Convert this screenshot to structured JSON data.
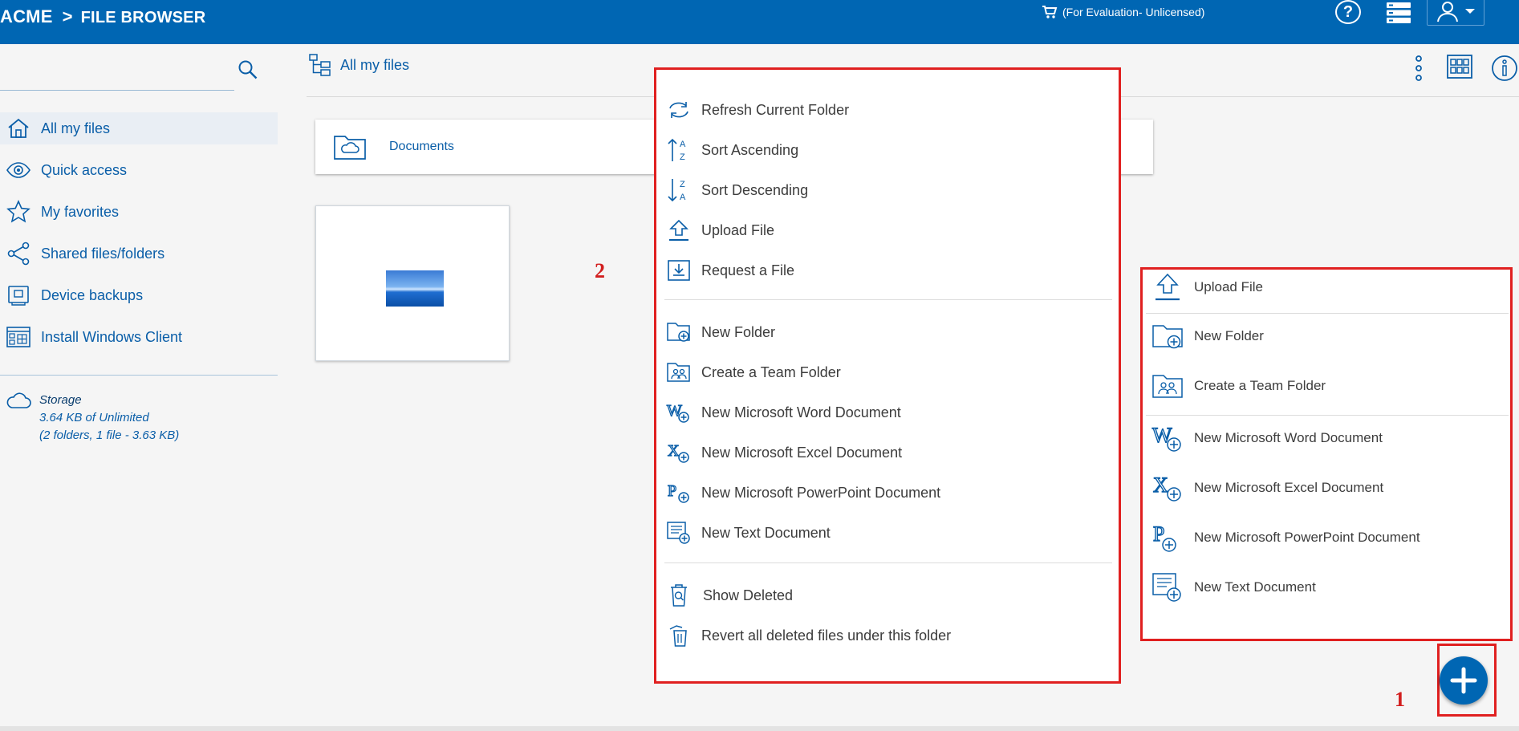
{
  "header": {
    "brand": "ACME",
    "separator": ">",
    "section": "FILE BROWSER",
    "license": "(For Evaluation- Unlicensed)",
    "help": "?"
  },
  "search": {
    "placeholder": ""
  },
  "sidebar": {
    "items": [
      {
        "label": "All my files",
        "icon": "home-icon"
      },
      {
        "label": "Quick access",
        "icon": "eye-icon"
      },
      {
        "label": "My favorites",
        "icon": "star-icon"
      },
      {
        "label": "Shared files/folders",
        "icon": "share-icon"
      },
      {
        "label": "Device backups",
        "icon": "device-backup-icon"
      },
      {
        "label": "Install Windows Client",
        "icon": "windows-client-icon"
      }
    ],
    "storage": {
      "title": "Storage",
      "usage": "3.64 KB of Unlimited",
      "details": "(2 folders, 1 file - 3.63 KB)"
    }
  },
  "breadcrumb": {
    "label": "All my files"
  },
  "files": {
    "folders": [
      {
        "name": "Documents"
      }
    ]
  },
  "context_menu": {
    "group1": [
      {
        "label": "Refresh Current Folder",
        "icon": "refresh-icon"
      },
      {
        "label": "Sort Ascending",
        "icon": "sort-ascending-icon"
      },
      {
        "label": "Sort Descending",
        "icon": "sort-descending-icon"
      },
      {
        "label": "Upload File",
        "icon": "upload-icon"
      },
      {
        "label": "Request a File",
        "icon": "request-file-icon"
      }
    ],
    "group2": [
      {
        "label": "New Folder",
        "icon": "new-folder-icon"
      },
      {
        "label": "Create a Team Folder",
        "icon": "team-folder-icon"
      },
      {
        "label": "New Microsoft Word Document",
        "icon": "word-add-icon"
      },
      {
        "label": "New Microsoft Excel Document",
        "icon": "excel-add-icon"
      },
      {
        "label": "New Microsoft PowerPoint Document",
        "icon": "powerpoint-add-icon"
      },
      {
        "label": "New Text Document",
        "icon": "text-document-icon"
      }
    ],
    "group3": [
      {
        "label": "Show Deleted",
        "icon": "show-deleted-icon"
      },
      {
        "label": "Revert all deleted files under this folder",
        "icon": "revert-deleted-icon"
      }
    ]
  },
  "quick_add": {
    "items": [
      {
        "label": "Upload File",
        "icon": "upload-icon"
      },
      {
        "label": "New Folder",
        "icon": "new-folder-icon"
      },
      {
        "label": "Create a Team Folder",
        "icon": "team-folder-icon"
      },
      {
        "label": "New Microsoft Word Document",
        "icon": "word-add-icon"
      },
      {
        "label": "New Microsoft Excel Document",
        "icon": "excel-add-icon"
      },
      {
        "label": "New Microsoft PowerPoint Document",
        "icon": "powerpoint-add-icon"
      },
      {
        "label": "New Text Document",
        "icon": "text-document-icon"
      }
    ]
  },
  "annotations": {
    "one": "1",
    "two": "2"
  },
  "colors": {
    "brand": "#0066b3",
    "highlight": "#e02020",
    "link": "#0a5ea8"
  }
}
